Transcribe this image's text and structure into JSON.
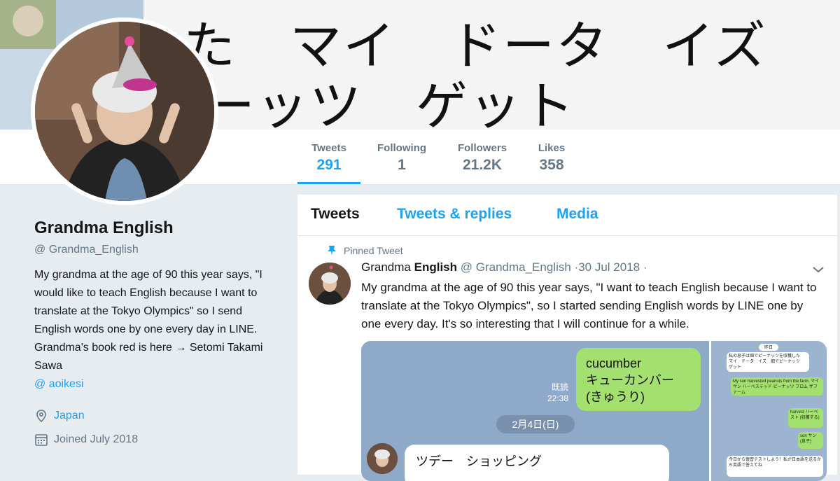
{
  "banner": {
    "line1": "た　マイ　ドータ　イズ",
    "line2": "ーッツ　ゲット"
  },
  "stats": [
    {
      "label": "Tweets",
      "value": "291"
    },
    {
      "label": "Following",
      "value": "1"
    },
    {
      "label": "Followers",
      "value": "21.2K"
    },
    {
      "label": "Likes",
      "value": "358"
    }
  ],
  "profile": {
    "name": "Grandma English",
    "handle": "@ Grandma_English",
    "bio": "My grandma at the age of 90 this year says, \"I would like to teach English because I want to translate at the Tokyo Olympics\" so I send English words one by one every day in LINE. Grandma's book red is here → Setomi Takami Sawa",
    "bio_link": "@ aoikesi",
    "location": "Japan",
    "joined": "Joined July 2018"
  },
  "tabs": [
    "Tweets",
    "Tweets & replies",
    "Media"
  ],
  "pinned_label": "Pinned Tweet",
  "tweet": {
    "name_first": "Grandma",
    "name_bold": "English",
    "handle": "@ Grandma_English",
    "date": "·30 Jul 2018 ·",
    "text": "My grandma at the age of 90 this year says, \"I want to teach English because I want to translate at the Tokyo Olympics\", so I started sending English words by LINE one by one every day. It's so interesting that I will continue for a while."
  },
  "media": {
    "green_bubble": [
      "cucumber",
      "キューカンバー",
      "(きゅうり)"
    ],
    "read_label": "既読",
    "read_time": "22:38",
    "date_pill": "2月4日(日)",
    "white_bubble": "ツデー　ショッピング",
    "side": {
      "date": "昨日",
      "msg1": "私の息子は畑でピーナッツを収穫した　マイ　ドータ　イズ　畑でピーナッツ　ゲット",
      "msg2": "My son harvested peanuts from the farm. マイサン ハーベステッド ピーナッツ フロム ザファーム",
      "msg3": "harvest ハーベスト (収穫する)",
      "msg4": "son サン (息子)",
      "msg5": "今日から復習テストしよう！私が日本語を送るから英語で答えてね"
    }
  },
  "colors": {
    "accent": "#1da1f2",
    "line_green": "#a3e070",
    "line_blue": "#8fa9c9"
  }
}
